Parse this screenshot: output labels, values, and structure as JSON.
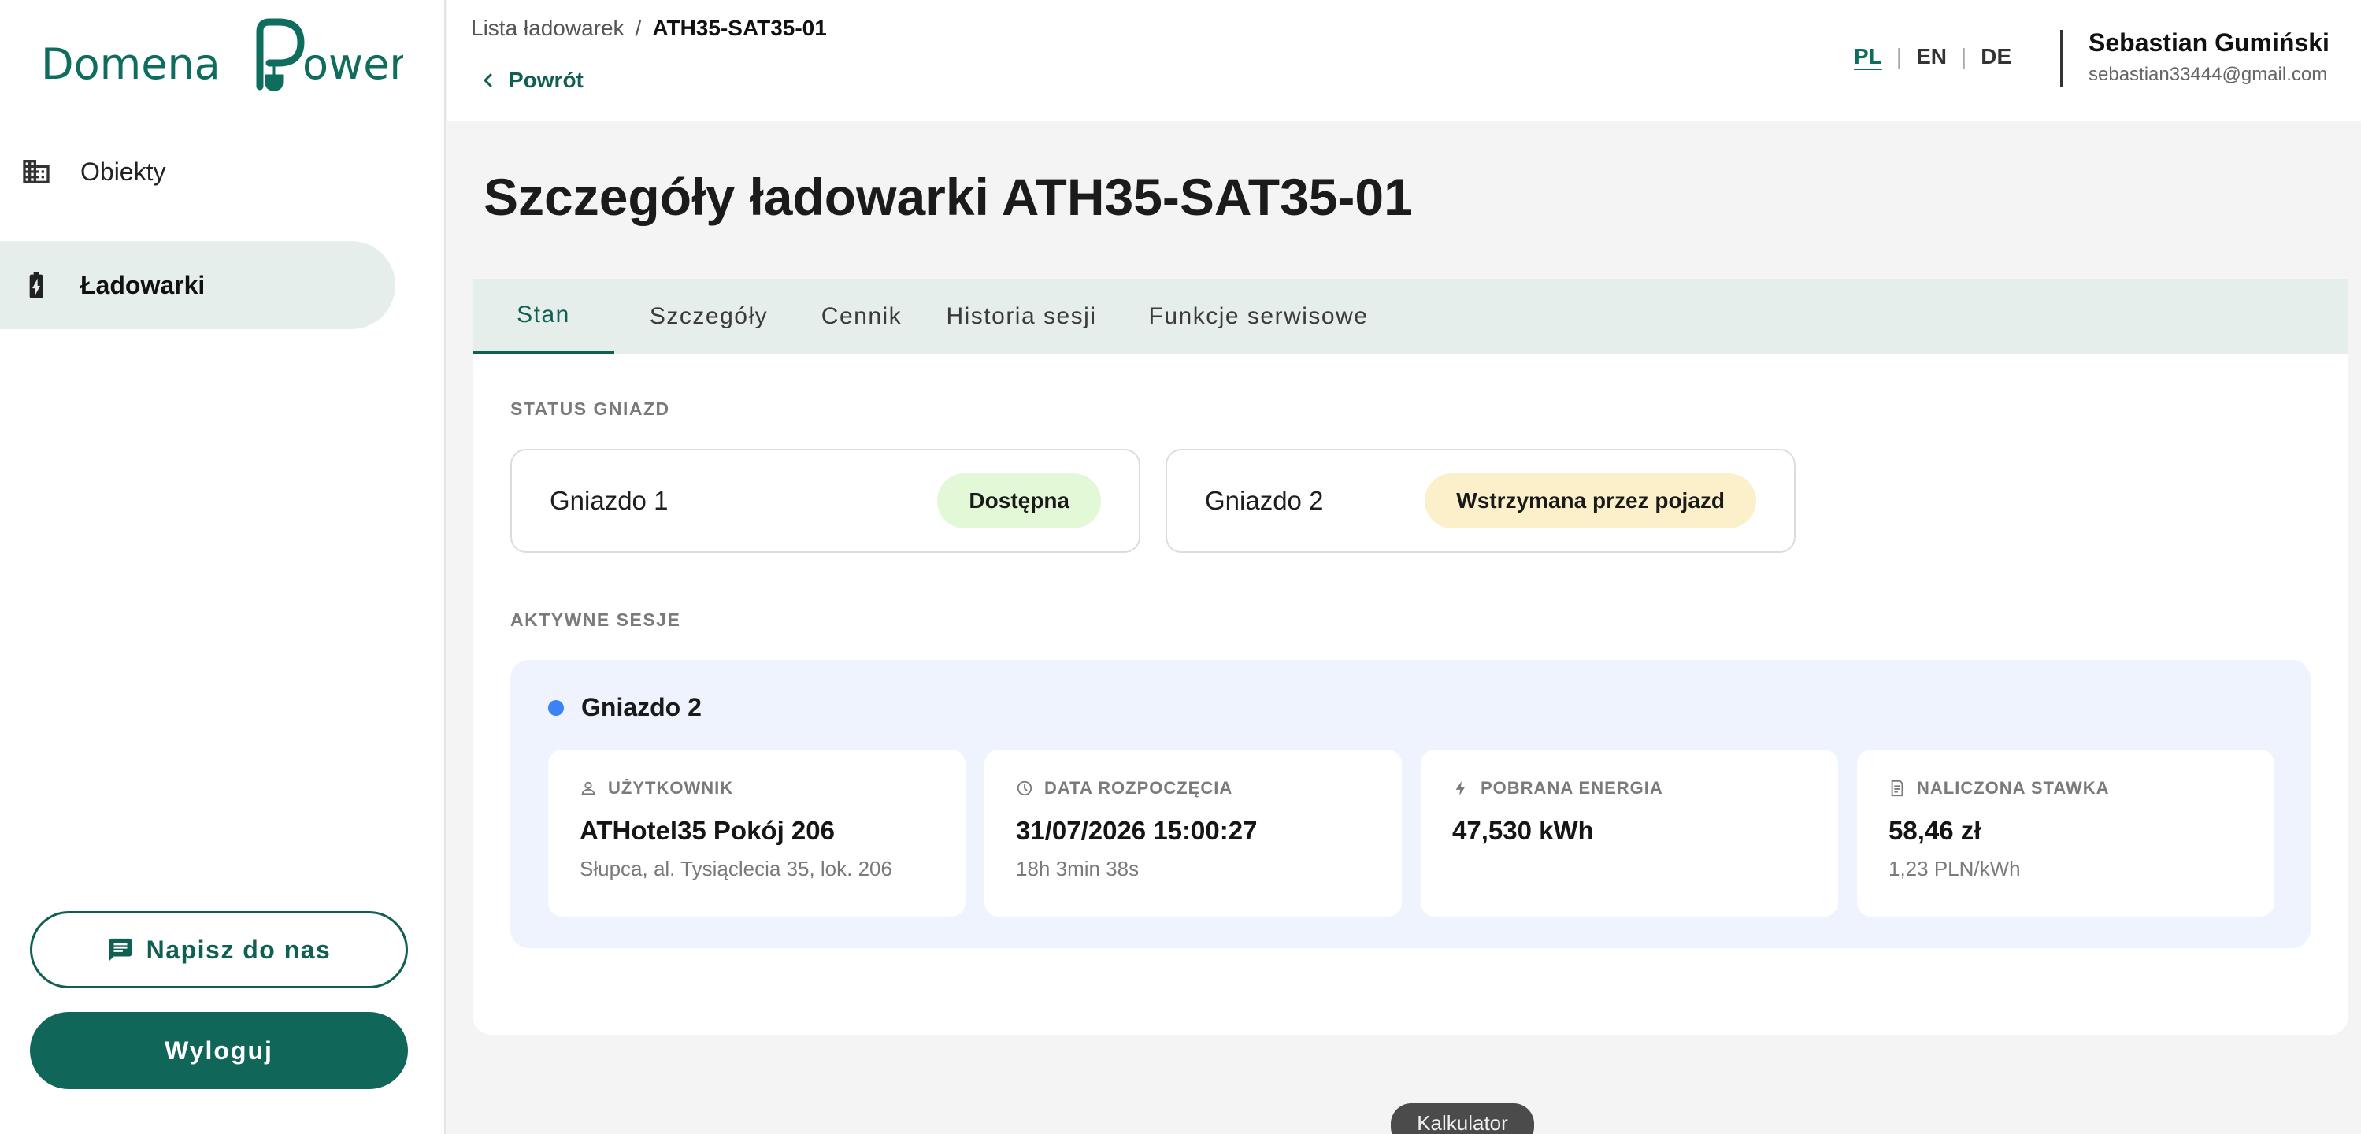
{
  "brand": {
    "logo_text": "Domena Power",
    "accent": "#0f5f52"
  },
  "sidebar": {
    "items": [
      {
        "label": "Obiekty",
        "icon": "building-icon",
        "active": false
      },
      {
        "label": "Ładowarki",
        "icon": "charger-icon",
        "active": true
      }
    ],
    "contact_label": "Napisz do nas",
    "logout_label": "Wyloguj"
  },
  "header": {
    "breadcrumb": {
      "parent": "Lista ładowarek",
      "separator": "/",
      "current": "ATH35-SAT35-01"
    },
    "back_label": "Powrót",
    "languages": [
      "PL",
      "EN",
      "DE"
    ],
    "active_language": "PL",
    "user": {
      "name": "Sebastian Gumiński",
      "email": "sebastian33444@gmail.com"
    }
  },
  "main": {
    "title": "Szczegóły ładowarki ATH35-SAT35-01",
    "tabs": [
      {
        "label": "Stan",
        "active": true
      },
      {
        "label": "Szczegóły",
        "active": false
      },
      {
        "label": "Cennik",
        "active": false
      },
      {
        "label": "Historia sesji",
        "active": false
      },
      {
        "label": "Funkcje serwisowe",
        "active": false
      }
    ],
    "sockets_heading": "STATUS GNIAZD",
    "sockets": [
      {
        "name": "Gniazdo 1",
        "status": "Dostępna",
        "status_color": "#e2f8d6"
      },
      {
        "name": "Gniazdo 2",
        "status": "Wstrzymana przez pojazd",
        "status_color": "#fbf0c9"
      }
    ],
    "sessions_heading": "AKTYWNE SESJE",
    "session": {
      "socket": "Gniazdo 2",
      "dot_color": "#3b82f6",
      "tiles": [
        {
          "icon": "user-icon",
          "label": "UŻYTKOWNIK",
          "value": "ATHotel35 Pokój 206",
          "sub": "Słupca, al. Tysiąclecia 35, lok. 206"
        },
        {
          "icon": "clock-icon",
          "label": "DATA ROZPOCZĘCIA",
          "value": "31/07/2026 15:00:27",
          "sub": "18h 3min 38s"
        },
        {
          "icon": "bolt-icon",
          "label": "POBRANA ENERGIA",
          "value": "47,530 kWh",
          "sub": ""
        },
        {
          "icon": "receipt-icon",
          "label": "NALICZONA STAWKA",
          "value": "58,46 zł",
          "sub": "1,23 PLN/kWh"
        }
      ]
    }
  },
  "floating": {
    "calculator_label": "Kalkulator"
  }
}
